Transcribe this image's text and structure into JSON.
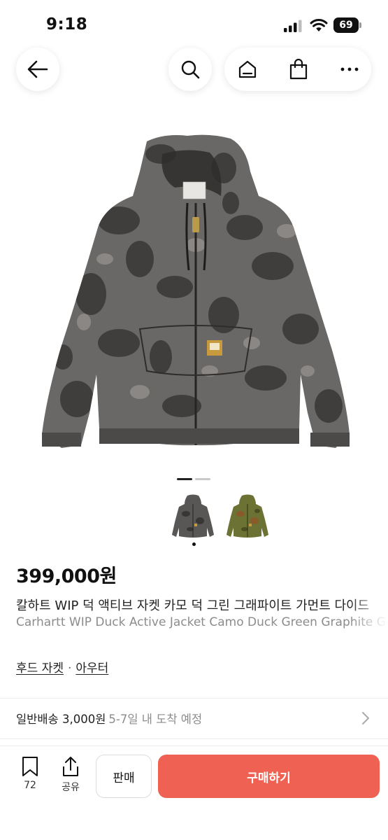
{
  "status_bar": {
    "time": "9:18",
    "battery": "69"
  },
  "nav": {
    "back_icon": "arrow-left-icon",
    "search_icon": "search-icon",
    "home_icon": "home-icon",
    "bag_icon": "shopping-bag-icon",
    "more_icon": "more-horizontal-icon"
  },
  "gallery": {
    "total_images": 2,
    "current_index": 1
  },
  "product": {
    "price": "399,000원",
    "title_ko": "칼하트 WIP 덕 액티브 자켓 카모 덕 그린 그래파이트 가먼트 다이드",
    "title_en": "Carhartt WIP Duck Active Jacket Camo Duck Green Graphite Garment Dyed",
    "category": {
      "primary": "후드 자켓",
      "separator": "·",
      "secondary": "아우터"
    }
  },
  "shipping": {
    "label": "일반배송 3,000원",
    "eta": "5-7일 내 도착 예정"
  },
  "bottom_bar": {
    "bookmark_count": "72",
    "share_label": "공유",
    "sell_label": "판매",
    "buy_label": "구매하기"
  },
  "colors": {
    "buy_button": "#ef6253",
    "jacket_camo": "#5a5a5a",
    "jacket_green": "#6b7233"
  }
}
